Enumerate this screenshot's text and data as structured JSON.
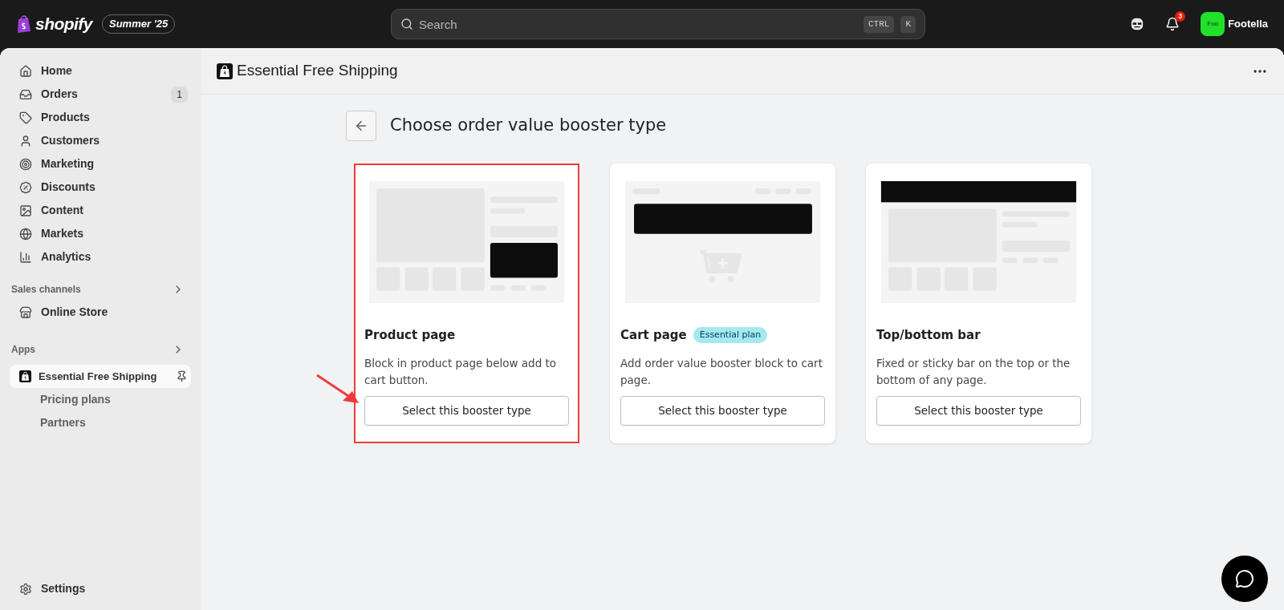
{
  "topbar": {
    "logo": "shopify",
    "edition": "Summer '25",
    "search": {
      "placeholder": "Search",
      "shortcut": [
        "CTRL",
        "K"
      ]
    },
    "notifications": "3",
    "store": {
      "avatar": "Foo",
      "name": "Footella"
    }
  },
  "sidebar": {
    "items": [
      {
        "label": "Home"
      },
      {
        "label": "Orders",
        "badge": "1"
      },
      {
        "label": "Products"
      },
      {
        "label": "Customers"
      },
      {
        "label": "Marketing"
      },
      {
        "label": "Discounts"
      },
      {
        "label": "Content"
      },
      {
        "label": "Markets"
      },
      {
        "label": "Analytics"
      }
    ],
    "sales_channels": {
      "title": "Sales channels",
      "items": [
        {
          "label": "Online Store"
        }
      ]
    },
    "apps": {
      "title": "Apps",
      "items": [
        {
          "label": "Essential Free Shipping",
          "selected": true,
          "children": [
            {
              "label": "Pricing plans"
            },
            {
              "label": "Partners"
            }
          ]
        }
      ]
    },
    "settings": "Settings"
  },
  "app_title": "Essential Free Shipping",
  "page": {
    "title": "Choose order value booster type",
    "cards": [
      {
        "kind": "product",
        "title": "Product page",
        "description": "Block in product page below add to cart button.",
        "button": "Select this booster type",
        "selected": true
      },
      {
        "kind": "cart",
        "title": "Cart page",
        "badge": "Essential plan",
        "description": "Add order value booster block to cart page.",
        "button": "Select this booster type",
        "selected": false
      },
      {
        "kind": "bar",
        "title": "Top/bottom bar",
        "description": "Fixed or sticky bar on the top or the bottom of any page.",
        "button": "Select this booster type",
        "selected": false
      }
    ]
  }
}
